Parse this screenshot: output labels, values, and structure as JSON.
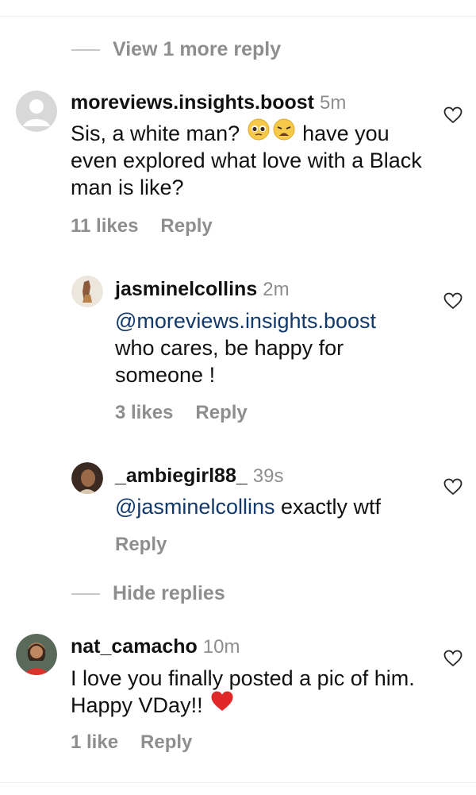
{
  "view_more": {
    "label": "View 1 more reply"
  },
  "hide_replies": {
    "label": "Hide replies"
  },
  "comments": [
    {
      "username": "moreviews.insights.boost",
      "time": "5m",
      "text_part1": "Sis, a white man? ",
      "text_part2": " have you even explored what love with a Black man is like?",
      "emojis": [
        "pleading-face-emoji",
        "weary-face-emoji"
      ],
      "likes": "11 likes",
      "reply": "Reply"
    },
    {
      "username": "jasminelcollins",
      "time": "2m",
      "mention": "@moreviews.insights.boost",
      "text": "who cares, be happy for someone !",
      "likes": "3 likes",
      "reply": "Reply"
    },
    {
      "username": "_ambiegirl88_",
      "time": "39s",
      "mention": "@jasminelcollins",
      "text": " exactly wtf",
      "reply": "Reply"
    },
    {
      "username": "nat_camacho",
      "time": "10m",
      "text": "I love you finally posted a pic of him. Happy VDay!! ",
      "emojis": [
        "red-heart-emoji"
      ],
      "likes": "1 like",
      "reply": "Reply"
    }
  ],
  "colors": {
    "text": "#111111",
    "secondary": "#8e8e8e",
    "mention": "#12396b",
    "divider": "#c7c7c7"
  }
}
